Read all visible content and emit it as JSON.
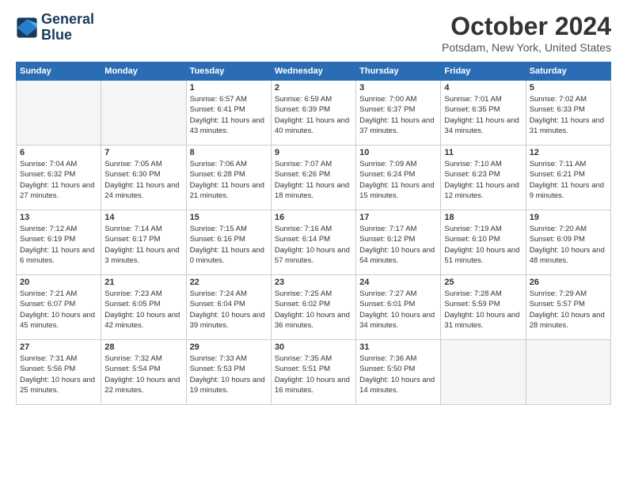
{
  "header": {
    "logo_line1": "General",
    "logo_line2": "Blue",
    "month": "October 2024",
    "location": "Potsdam, New York, United States"
  },
  "weekdays": [
    "Sunday",
    "Monday",
    "Tuesday",
    "Wednesday",
    "Thursday",
    "Friday",
    "Saturday"
  ],
  "weeks": [
    [
      {
        "day": "",
        "empty": true
      },
      {
        "day": "",
        "empty": true
      },
      {
        "day": "1",
        "sunrise": "Sunrise: 6:57 AM",
        "sunset": "Sunset: 6:41 PM",
        "daylight": "Daylight: 11 hours and 43 minutes."
      },
      {
        "day": "2",
        "sunrise": "Sunrise: 6:59 AM",
        "sunset": "Sunset: 6:39 PM",
        "daylight": "Daylight: 11 hours and 40 minutes."
      },
      {
        "day": "3",
        "sunrise": "Sunrise: 7:00 AM",
        "sunset": "Sunset: 6:37 PM",
        "daylight": "Daylight: 11 hours and 37 minutes."
      },
      {
        "day": "4",
        "sunrise": "Sunrise: 7:01 AM",
        "sunset": "Sunset: 6:35 PM",
        "daylight": "Daylight: 11 hours and 34 minutes."
      },
      {
        "day": "5",
        "sunrise": "Sunrise: 7:02 AM",
        "sunset": "Sunset: 6:33 PM",
        "daylight": "Daylight: 11 hours and 31 minutes."
      }
    ],
    [
      {
        "day": "6",
        "sunrise": "Sunrise: 7:04 AM",
        "sunset": "Sunset: 6:32 PM",
        "daylight": "Daylight: 11 hours and 27 minutes."
      },
      {
        "day": "7",
        "sunrise": "Sunrise: 7:05 AM",
        "sunset": "Sunset: 6:30 PM",
        "daylight": "Daylight: 11 hours and 24 minutes."
      },
      {
        "day": "8",
        "sunrise": "Sunrise: 7:06 AM",
        "sunset": "Sunset: 6:28 PM",
        "daylight": "Daylight: 11 hours and 21 minutes."
      },
      {
        "day": "9",
        "sunrise": "Sunrise: 7:07 AM",
        "sunset": "Sunset: 6:26 PM",
        "daylight": "Daylight: 11 hours and 18 minutes."
      },
      {
        "day": "10",
        "sunrise": "Sunrise: 7:09 AM",
        "sunset": "Sunset: 6:24 PM",
        "daylight": "Daylight: 11 hours and 15 minutes."
      },
      {
        "day": "11",
        "sunrise": "Sunrise: 7:10 AM",
        "sunset": "Sunset: 6:23 PM",
        "daylight": "Daylight: 11 hours and 12 minutes."
      },
      {
        "day": "12",
        "sunrise": "Sunrise: 7:11 AM",
        "sunset": "Sunset: 6:21 PM",
        "daylight": "Daylight: 11 hours and 9 minutes."
      }
    ],
    [
      {
        "day": "13",
        "sunrise": "Sunrise: 7:12 AM",
        "sunset": "Sunset: 6:19 PM",
        "daylight": "Daylight: 11 hours and 6 minutes."
      },
      {
        "day": "14",
        "sunrise": "Sunrise: 7:14 AM",
        "sunset": "Sunset: 6:17 PM",
        "daylight": "Daylight: 11 hours and 3 minutes."
      },
      {
        "day": "15",
        "sunrise": "Sunrise: 7:15 AM",
        "sunset": "Sunset: 6:16 PM",
        "daylight": "Daylight: 11 hours and 0 minutes."
      },
      {
        "day": "16",
        "sunrise": "Sunrise: 7:16 AM",
        "sunset": "Sunset: 6:14 PM",
        "daylight": "Daylight: 10 hours and 57 minutes."
      },
      {
        "day": "17",
        "sunrise": "Sunrise: 7:17 AM",
        "sunset": "Sunset: 6:12 PM",
        "daylight": "Daylight: 10 hours and 54 minutes."
      },
      {
        "day": "18",
        "sunrise": "Sunrise: 7:19 AM",
        "sunset": "Sunset: 6:10 PM",
        "daylight": "Daylight: 10 hours and 51 minutes."
      },
      {
        "day": "19",
        "sunrise": "Sunrise: 7:20 AM",
        "sunset": "Sunset: 6:09 PM",
        "daylight": "Daylight: 10 hours and 48 minutes."
      }
    ],
    [
      {
        "day": "20",
        "sunrise": "Sunrise: 7:21 AM",
        "sunset": "Sunset: 6:07 PM",
        "daylight": "Daylight: 10 hours and 45 minutes."
      },
      {
        "day": "21",
        "sunrise": "Sunrise: 7:23 AM",
        "sunset": "Sunset: 6:05 PM",
        "daylight": "Daylight: 10 hours and 42 minutes."
      },
      {
        "day": "22",
        "sunrise": "Sunrise: 7:24 AM",
        "sunset": "Sunset: 6:04 PM",
        "daylight": "Daylight: 10 hours and 39 minutes."
      },
      {
        "day": "23",
        "sunrise": "Sunrise: 7:25 AM",
        "sunset": "Sunset: 6:02 PM",
        "daylight": "Daylight: 10 hours and 36 minutes."
      },
      {
        "day": "24",
        "sunrise": "Sunrise: 7:27 AM",
        "sunset": "Sunset: 6:01 PM",
        "daylight": "Daylight: 10 hours and 34 minutes."
      },
      {
        "day": "25",
        "sunrise": "Sunrise: 7:28 AM",
        "sunset": "Sunset: 5:59 PM",
        "daylight": "Daylight: 10 hours and 31 minutes."
      },
      {
        "day": "26",
        "sunrise": "Sunrise: 7:29 AM",
        "sunset": "Sunset: 5:57 PM",
        "daylight": "Daylight: 10 hours and 28 minutes."
      }
    ],
    [
      {
        "day": "27",
        "sunrise": "Sunrise: 7:31 AM",
        "sunset": "Sunset: 5:56 PM",
        "daylight": "Daylight: 10 hours and 25 minutes."
      },
      {
        "day": "28",
        "sunrise": "Sunrise: 7:32 AM",
        "sunset": "Sunset: 5:54 PM",
        "daylight": "Daylight: 10 hours and 22 minutes."
      },
      {
        "day": "29",
        "sunrise": "Sunrise: 7:33 AM",
        "sunset": "Sunset: 5:53 PM",
        "daylight": "Daylight: 10 hours and 19 minutes."
      },
      {
        "day": "30",
        "sunrise": "Sunrise: 7:35 AM",
        "sunset": "Sunset: 5:51 PM",
        "daylight": "Daylight: 10 hours and 16 minutes."
      },
      {
        "day": "31",
        "sunrise": "Sunrise: 7:36 AM",
        "sunset": "Sunset: 5:50 PM",
        "daylight": "Daylight: 10 hours and 14 minutes."
      },
      {
        "day": "",
        "empty": true
      },
      {
        "day": "",
        "empty": true
      }
    ]
  ]
}
